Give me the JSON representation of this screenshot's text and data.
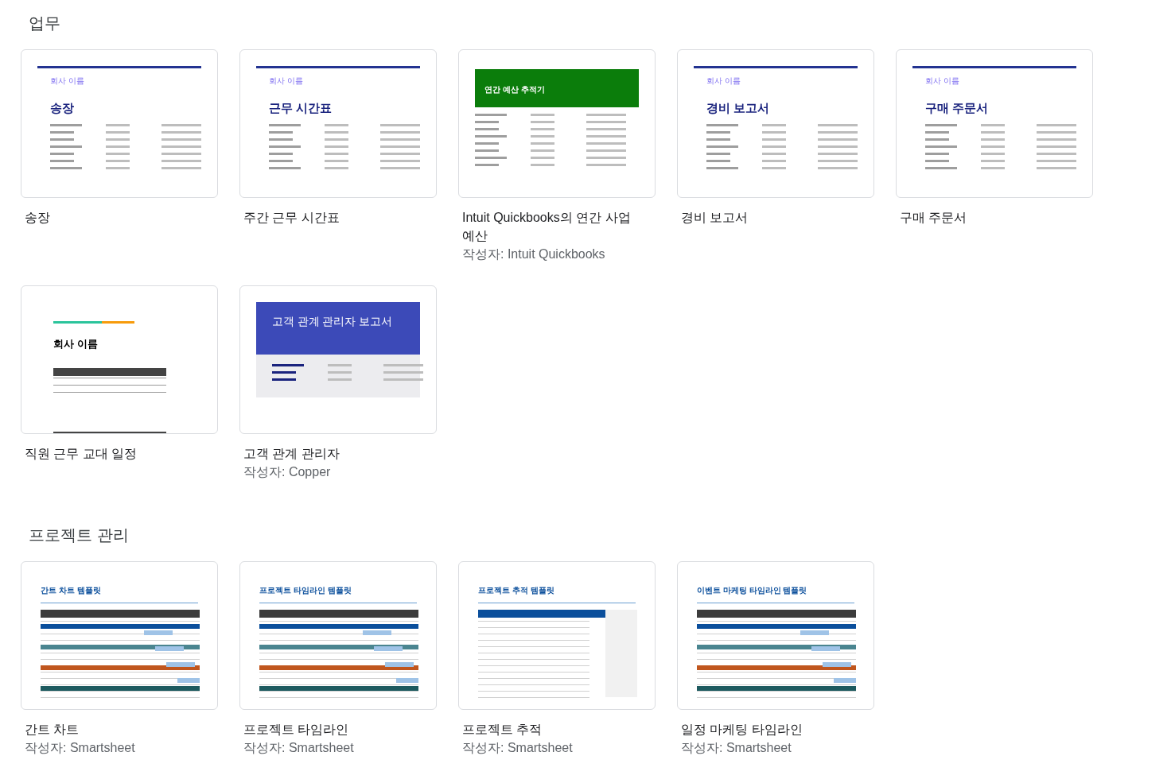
{
  "sections": [
    {
      "title": "업무",
      "templates": [
        {
          "title": "송장",
          "preview": {
            "kind": "letterhead",
            "company": "회사 이름",
            "heading": "송장"
          }
        },
        {
          "title": "주간 근무 시간표",
          "preview": {
            "kind": "letterhead",
            "company": "회사 이름",
            "heading": "근무 시간표"
          }
        },
        {
          "title": "Intuit Quickbooks의 연간 사업 예산",
          "author": "작성자: Intuit Quickbooks",
          "preview": {
            "kind": "banner",
            "heading": "연간 예산 추적기"
          }
        },
        {
          "title": "경비 보고서",
          "preview": {
            "kind": "letterhead",
            "company": "회사 이름",
            "heading": "경비 보고서"
          }
        },
        {
          "title": "구매 주문서",
          "preview": {
            "kind": "letterhead",
            "company": "회사 이름",
            "heading": "구매 주문서"
          }
        },
        {
          "title": "직원 근무 교대 일정",
          "preview": {
            "kind": "shift",
            "heading": "회사 이름"
          }
        },
        {
          "title": "고객 관계 관리자",
          "author": "작성자: Copper",
          "preview": {
            "kind": "report",
            "heading": "고객 관계 관리자 보고서"
          }
        }
      ]
    },
    {
      "title": "프로젝트 관리",
      "templates": [
        {
          "title": "간트 차트",
          "author": "작성자: Smartsheet",
          "preview": {
            "kind": "sheet",
            "heading": "간트 차트 템플릿"
          }
        },
        {
          "title": "프로젝트 타임라인",
          "author": "작성자: Smartsheet",
          "preview": {
            "kind": "sheet",
            "heading": "프로젝트 타임라인 템플릿"
          }
        },
        {
          "title": "프로젝트 추적",
          "author": "작성자: Smartsheet",
          "preview": {
            "kind": "tracker",
            "heading": "프로젝트 추적 템플릿"
          }
        },
        {
          "title": "일정 마케팅 타임라인",
          "author": "작성자: Smartsheet",
          "preview": {
            "kind": "sheet",
            "heading": "이벤트 마케팅 타임라인 템플릿"
          }
        }
      ]
    }
  ]
}
